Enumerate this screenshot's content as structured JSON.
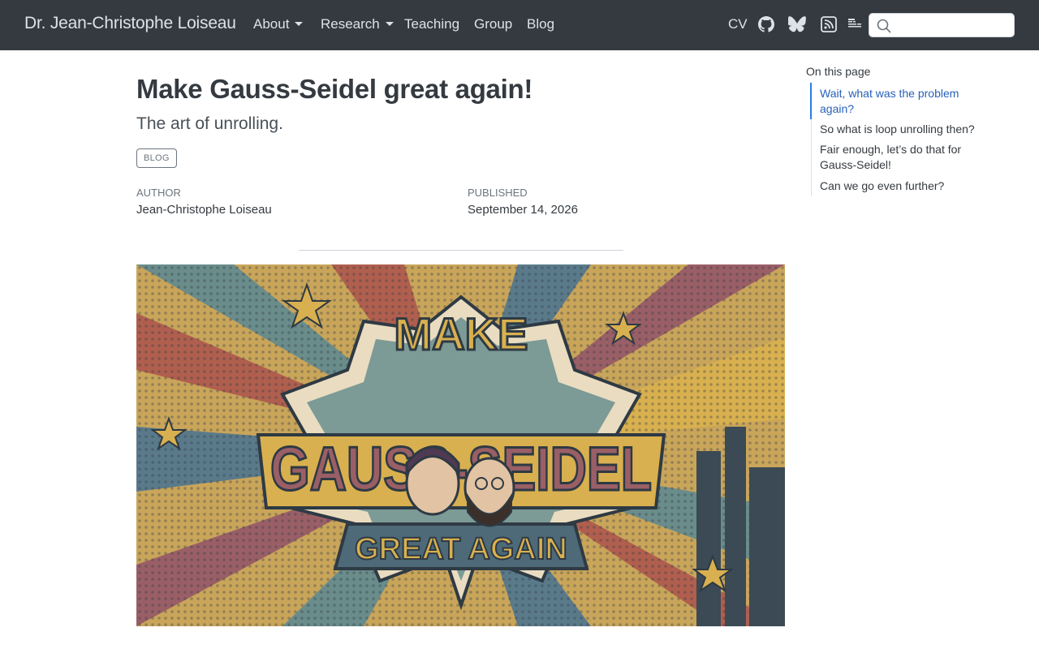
{
  "navbar": {
    "brand": "Dr. Jean-Christophe Loiseau",
    "links": [
      {
        "label": "About",
        "dropdown": true
      },
      {
        "label": "Research",
        "dropdown": true
      },
      {
        "label": "Teaching",
        "dropdown": false
      },
      {
        "label": "Group",
        "dropdown": false
      },
      {
        "label": "Blog",
        "dropdown": false
      }
    ],
    "cv_label": "CV",
    "icons": [
      "github-icon",
      "bluesky-icon",
      "rss-icon",
      "scholar-icon"
    ],
    "search": {
      "value": "",
      "placeholder": ""
    }
  },
  "post": {
    "title": "Make Gauss-Seidel great again!",
    "subtitle": "The art of unrolling.",
    "category": "BLOG",
    "author_label": "Author",
    "author": "Jean-Christophe Loiseau",
    "published_label": "Published",
    "published": "September 14, 2026"
  },
  "hero_image": {
    "lines": [
      "MAKE",
      "GAUSS-SEIDEL",
      "GREAT AGAIN"
    ]
  },
  "toc": {
    "title": "On this page",
    "items": [
      {
        "label": "Wait, what was the problem again?",
        "active": true
      },
      {
        "label": "So what is loop unrolling then?",
        "active": false
      },
      {
        "label": "Fair enough, let’s do that for Gauss-Seidel!",
        "active": false
      },
      {
        "label": "Can we go even further?",
        "active": false
      }
    ]
  },
  "colors": {
    "navbar_bg": "#343a40",
    "nav_text": "#dee2e6",
    "toc_active": "#2761b8"
  }
}
